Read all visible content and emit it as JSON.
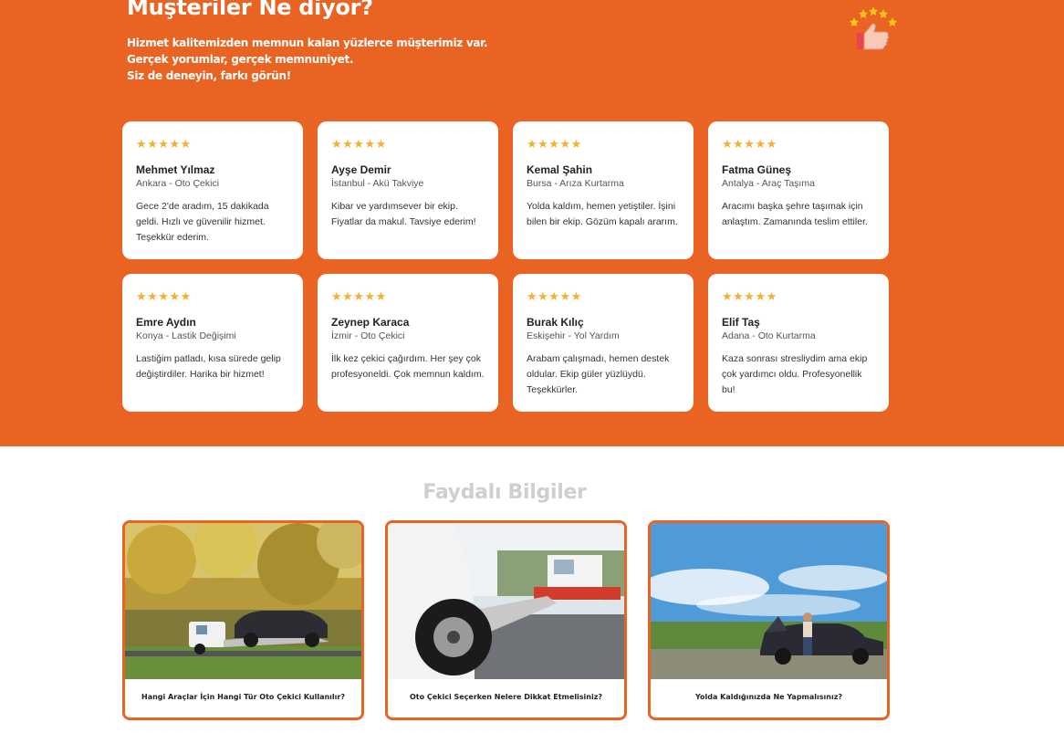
{
  "hero": {
    "title": "Müşteriler Ne diyor?",
    "subtitle_lines": [
      "Hizmet kalitemizden memnun kalan yüzlerce müşterimiz var.",
      "Gerçek yorumlar, gerçek memnuniyet.",
      "Siz de deneyin, farkı görün!"
    ],
    "icon": "thumbs-up-stars-icon"
  },
  "colors": {
    "brand_orange": "#e96322",
    "star": "#f2b132",
    "section_title": "#cfcfcf"
  },
  "reviews": [
    {
      "stars": "★★★★★",
      "rating": 5,
      "name": "Mehmet Yılmaz",
      "location": "Ankara - Oto Çekici",
      "text": "Gece 2'de aradım, 15 dakikada geldi. Hızlı ve güvenilir hizmet. Teşekkür ederim."
    },
    {
      "stars": "★★★★★",
      "rating": 5,
      "name": "Ayşe Demir",
      "location": "İstanbul - Akü Takviye",
      "text": "Kibar ve yardımsever bir ekip. Fiyatlar da makul. Tavsiye ederim!"
    },
    {
      "stars": "★★★★★",
      "rating": 5,
      "name": "Kemal Şahin",
      "location": "Bursa - Arıza Kurtarma",
      "text": "Yolda kaldım, hemen yetiştiler. İşini bilen bir ekip. Gözüm kapalı ararım."
    },
    {
      "stars": "★★★★★",
      "rating": 5,
      "name": "Fatma Güneş",
      "location": "Antalya - Araç Taşıma",
      "text": "Aracımı başka şehre taşımak için anlaştım. Zamanında teslim ettiler."
    },
    {
      "stars": "★★★★★",
      "rating": 5,
      "name": "Emre Aydın",
      "location": "Konya - Lastik Değişimi",
      "text": "Lastiğim patladı, kısa sürede gelip değiştirdiler. Harika bir hizmet!"
    },
    {
      "stars": "★★★★★",
      "rating": 5,
      "name": "Zeynep Karaca",
      "location": "İzmir - Oto Çekici",
      "text": "İlk kez çekici çağırdım. Her şey çok profesyoneldi. Çok memnun kaldım."
    },
    {
      "stars": "★★★★★",
      "rating": 5,
      "name": "Burak Kılıç",
      "location": "Eskişehir - Yol Yardım",
      "text": "Arabam çalışmadı, hemen destek oldular. Ekip güler yüzlüydü. Teşekkürler."
    },
    {
      "stars": "★★★★★",
      "rating": 5,
      "name": "Elif Taş",
      "location": "Adana - Oto Kurtarma",
      "text": "Kaza sonrası stresliydim ama ekip çok yardımcı oldu. Profesyonellik bu!"
    }
  ],
  "info": {
    "title": "Faydalı Bilgiler",
    "articles": [
      {
        "caption": "Hangi Araçlar İçin Hangi Tür Oto Çekici Kullanılır?"
      },
      {
        "caption": "Oto Çekici Seçerken Nelere Dikkat Etmelisiniz?"
      },
      {
        "caption": "Yolda Kaldığınızda Ne Yapmalısınız?"
      }
    ]
  }
}
